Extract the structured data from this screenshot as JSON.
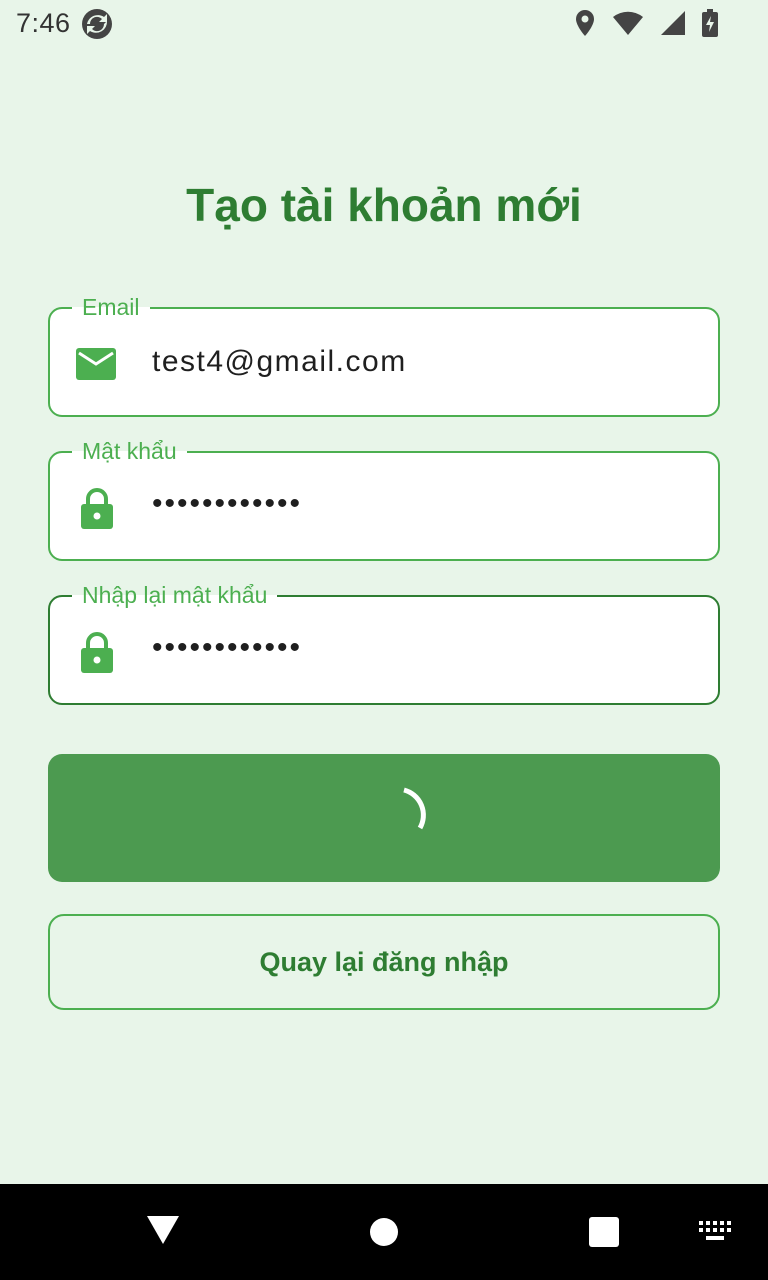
{
  "status_bar": {
    "time": "7:46"
  },
  "title": "Tạo tài khoản mới",
  "form": {
    "email": {
      "label": "Email",
      "value": "test4@gmail.com",
      "icon": "mail-icon"
    },
    "password": {
      "label": "Mật khẩu",
      "value": "••••••••••••",
      "icon": "lock-icon"
    },
    "confirm_password": {
      "label": "Nhập lại mật khẩu",
      "value": "••••••••••••",
      "icon": "lock-icon"
    }
  },
  "submit": {
    "state": "loading"
  },
  "back_button": {
    "label": "Quay lại đăng nhập"
  },
  "colors": {
    "primary": "#4caf50",
    "primary_dark": "#2e7d32",
    "button": "#4c9a50",
    "background": "#e8f5e9"
  }
}
